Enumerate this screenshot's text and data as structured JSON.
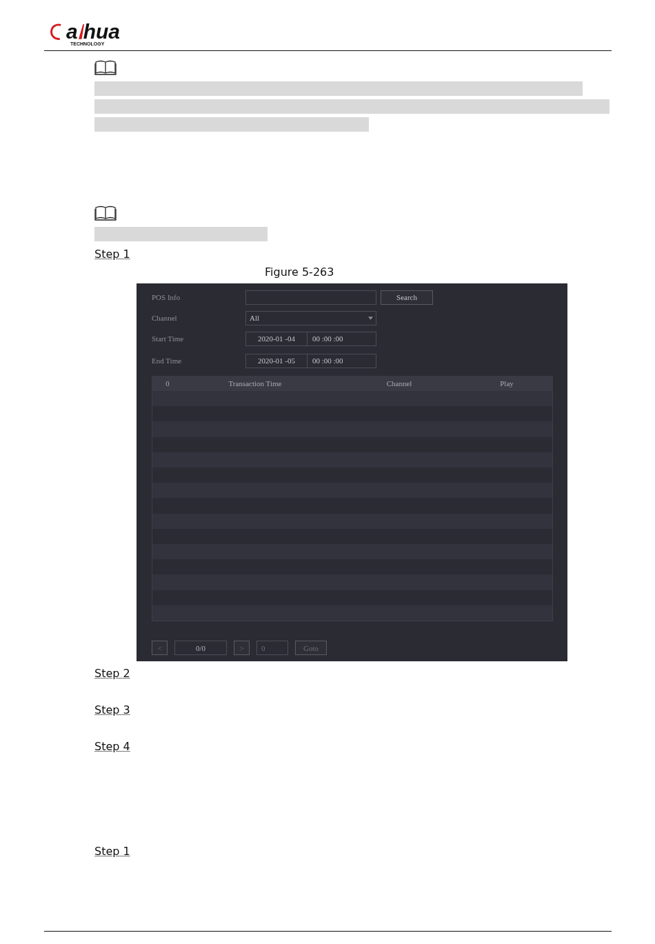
{
  "header": {
    "logo": {
      "parts": [
        "a",
        "hua"
      ],
      "tagline": "TECHNOLOGY"
    }
  },
  "notes": [
    {
      "lines": [
        {
          "kind": "redacted"
        },
        {
          "kind": "redacted"
        },
        {
          "kind": "redacted"
        }
      ]
    },
    {
      "lines": [
        {
          "kind": "redacted"
        }
      ]
    }
  ],
  "steps_before": [
    "Step 1"
  ],
  "figure": {
    "caption": "Figure 5-263",
    "form": [
      {
        "label": "POS Info",
        "kind": "text"
      },
      {
        "label": "Channel",
        "kind": "select",
        "value": "All"
      },
      {
        "label": "Start Time",
        "kind": "datetime",
        "date": "2020-01 -04",
        "time": "00 :00 :00"
      },
      {
        "label": "End Time",
        "kind": "datetime",
        "date": "2020-01 -05",
        "time": "00 :00 :00"
      }
    ],
    "search_button": "Search",
    "table": {
      "columns": [
        "0",
        "Transaction Time",
        "Channel",
        "Play"
      ]
    },
    "pager": {
      "prev": {
        "label": "<",
        "disabled": true
      },
      "page_count": "0/0",
      "next": {
        "label": ">",
        "disabled": true
      },
      "page_input": "0",
      "goto": {
        "label": "Goto",
        "disabled": true
      }
    }
  },
  "steps_after": [
    "Step 2",
    "Step 3",
    "Step 4",
    "Step 1"
  ]
}
